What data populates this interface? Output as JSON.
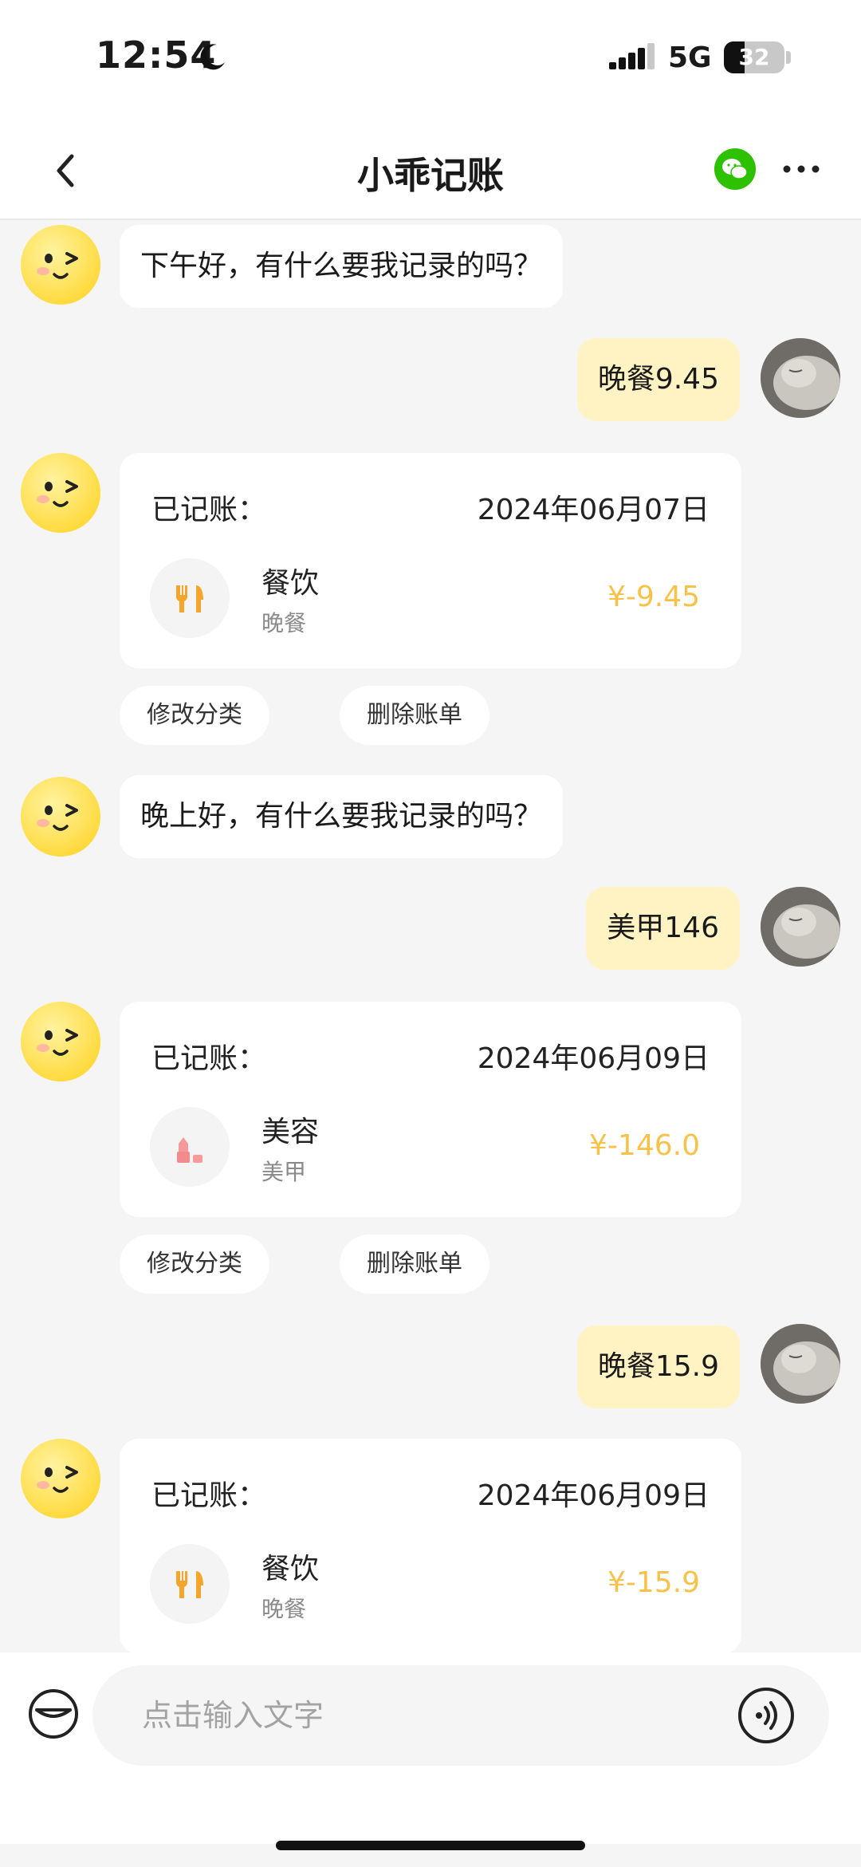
{
  "status_bar": {
    "time": "12:54",
    "network": "5G",
    "battery": "32"
  },
  "header": {
    "title": "小乖记账"
  },
  "messages": [
    {
      "type": "bot_text",
      "text": "下午好，有什么要我记录的吗？"
    },
    {
      "type": "user_text",
      "text": "晚餐9.45"
    },
    {
      "type": "bot_card",
      "label": "已记账：",
      "date": "2024年06月07日",
      "category": "餐饮",
      "note": "晚餐",
      "amount": "¥-9.45",
      "icon": "utensils-icon"
    },
    {
      "type": "actions",
      "edit": "修改分类",
      "delete": "删除账单"
    },
    {
      "type": "bot_text",
      "text": "晚上好，有什么要我记录的吗？"
    },
    {
      "type": "user_text",
      "text": "美甲146"
    },
    {
      "type": "bot_card",
      "label": "已记账：",
      "date": "2024年06月09日",
      "category": "美容",
      "note": "美甲",
      "amount": "¥-146.0",
      "icon": "lipstick-icon"
    },
    {
      "type": "actions",
      "edit": "修改分类",
      "delete": "删除账单"
    },
    {
      "type": "user_text",
      "text": "晚餐15.9"
    },
    {
      "type": "bot_card",
      "label": "已记账：",
      "date": "2024年06月09日",
      "category": "餐饮",
      "note": "晚餐",
      "amount": "¥-15.9",
      "icon": "utensils-icon"
    }
  ],
  "input": {
    "placeholder": "点击输入文字"
  },
  "colors": {
    "accent": "#f7c247",
    "user_bubble": "#fff3c4",
    "wechat": "#2dc100"
  }
}
